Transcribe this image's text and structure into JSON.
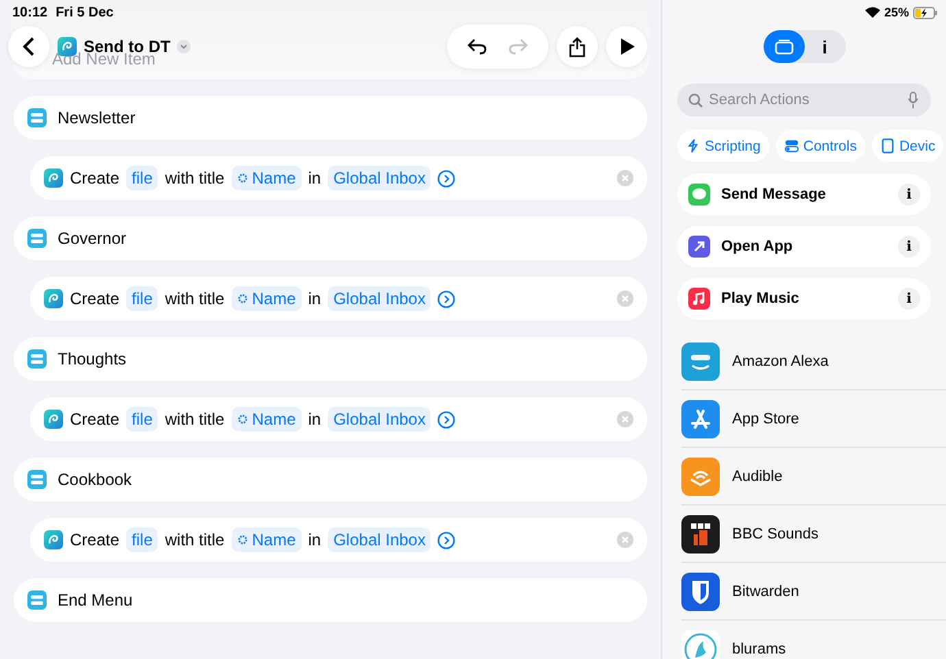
{
  "status_bar": {
    "time": "10:12",
    "date": "Fri 5 Dec",
    "battery": "25%",
    "charging": true
  },
  "header": {
    "title": "Send to DT",
    "behind_text": "Add New Item"
  },
  "editor": [
    {
      "kind": "menu_item",
      "label": "Newsletter"
    },
    {
      "kind": "action",
      "verb": "Create",
      "type": "file",
      "with": "with title",
      "variable": "Name",
      "in": "in",
      "folder": "Global Inbox"
    },
    {
      "kind": "menu_item",
      "label": "Governor"
    },
    {
      "kind": "action",
      "verb": "Create",
      "type": "file",
      "with": "with title",
      "variable": "Name",
      "in": "in",
      "folder": "Global Inbox"
    },
    {
      "kind": "menu_item",
      "label": "Thoughts"
    },
    {
      "kind": "action",
      "verb": "Create",
      "type": "file",
      "with": "with title",
      "variable": "Name",
      "in": "in",
      "folder": "Global Inbox"
    },
    {
      "kind": "menu_item",
      "label": "Cookbook"
    },
    {
      "kind": "action",
      "verb": "Create",
      "type": "file",
      "with": "with title",
      "variable": "Name",
      "in": "in",
      "folder": "Global Inbox"
    },
    {
      "kind": "menu_item",
      "label": "End Menu"
    }
  ],
  "sidebar": {
    "segments": [
      {
        "kind": "library",
        "selected": true
      },
      {
        "kind": "info",
        "label": "i",
        "selected": false
      }
    ],
    "search": {
      "placeholder": "Search Actions"
    },
    "chips": [
      {
        "kind": "scripting",
        "label": "Scripting"
      },
      {
        "kind": "controls",
        "label": "Controls"
      },
      {
        "kind": "device",
        "label": "Devic"
      }
    ],
    "suggestions": [
      {
        "kind": "message",
        "label": "Send Message",
        "info": "i"
      },
      {
        "kind": "open_app",
        "label": "Open App",
        "info": "i"
      },
      {
        "kind": "music",
        "label": "Play Music",
        "info": "i"
      }
    ],
    "apps": [
      {
        "kind": "alexa",
        "label": "Amazon Alexa"
      },
      {
        "kind": "appstore",
        "label": "App Store"
      },
      {
        "kind": "audible",
        "label": "Audible"
      },
      {
        "kind": "bbc",
        "label": "BBC Sounds"
      },
      {
        "kind": "bitwarden",
        "label": "Bitwarden"
      },
      {
        "kind": "blurams",
        "label": "blurams"
      }
    ]
  }
}
